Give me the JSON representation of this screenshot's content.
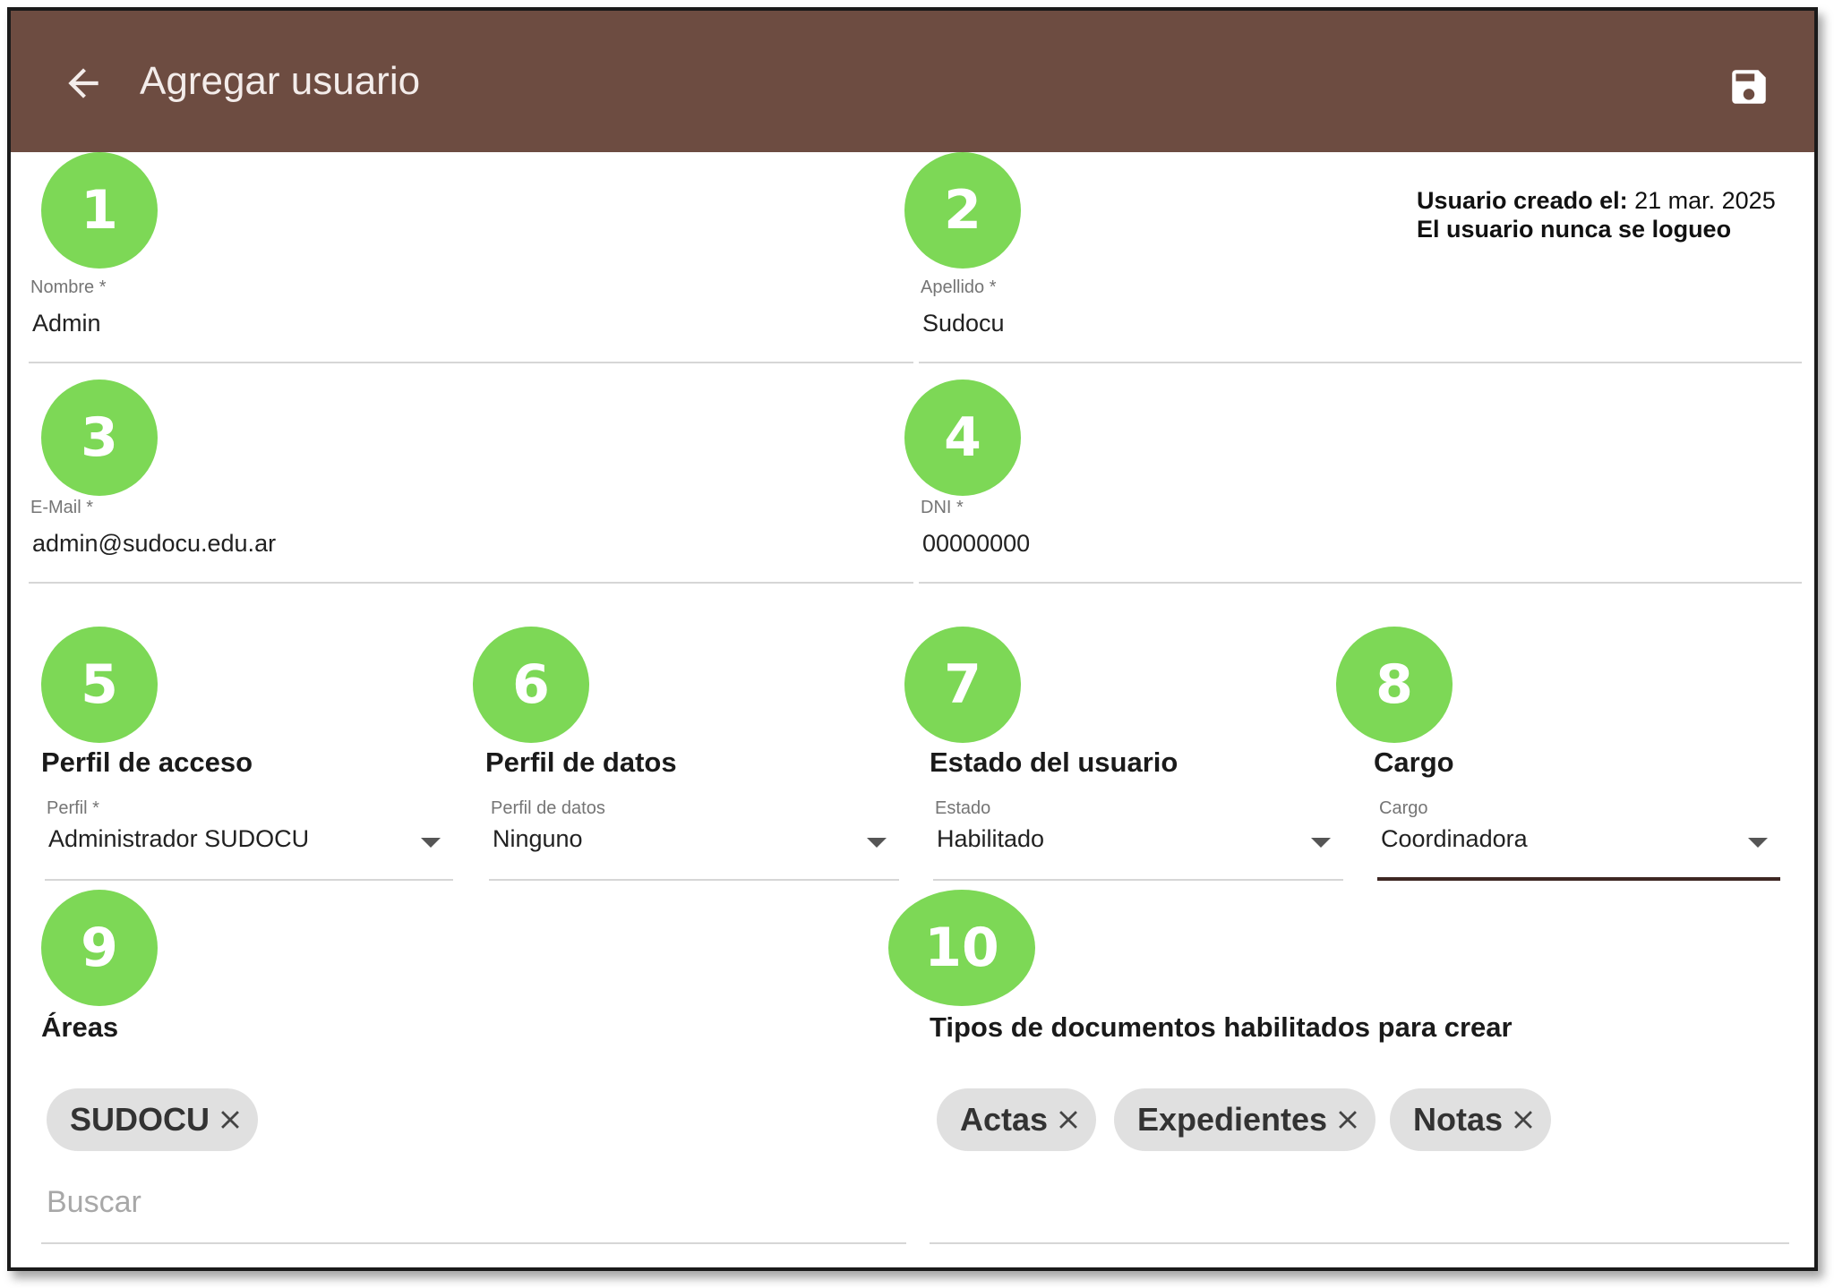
{
  "appbar": {
    "title": "Agregar usuario",
    "back_icon": "arrow-left-icon",
    "save_icon": "floppy-disk-icon",
    "color": "#6d4c41"
  },
  "badges": [
    "1",
    "2",
    "3",
    "4",
    "5",
    "6",
    "7",
    "8",
    "9",
    "10"
  ],
  "badge_color": "#7dd856",
  "info": {
    "created_label": "Usuario creado el:",
    "created_value": "21 mar. 2025",
    "login_status": "El usuario nunca se logueo"
  },
  "fields": {
    "nombre": {
      "label": "Nombre *",
      "value": "Admin"
    },
    "apellido": {
      "label": "Apellido *",
      "value": "Sudocu"
    },
    "email": {
      "label": "E-Mail *",
      "value": "admin@sudocu.edu.ar"
    },
    "dni": {
      "label": "DNI *",
      "value": "00000000"
    }
  },
  "sections": {
    "perfil_acceso": {
      "title": "Perfil de acceso",
      "label": "Perfil *",
      "value": "Administrador SUDOCU"
    },
    "perfil_datos": {
      "title": "Perfil de datos",
      "label": "Perfil de datos",
      "value": "Ninguno"
    },
    "estado": {
      "title": "Estado del usuario",
      "label": "Estado",
      "value": "Habilitado"
    },
    "cargo": {
      "title": "Cargo",
      "label": "Cargo",
      "value": "Coordinadora"
    },
    "areas": {
      "title": "Áreas",
      "chips": [
        "SUDOCU"
      ],
      "search_placeholder": "Buscar"
    },
    "tipos": {
      "title": "Tipos de documentos habilitados para crear",
      "chips": [
        "Actas",
        "Expedientes",
        "Notas"
      ]
    }
  }
}
